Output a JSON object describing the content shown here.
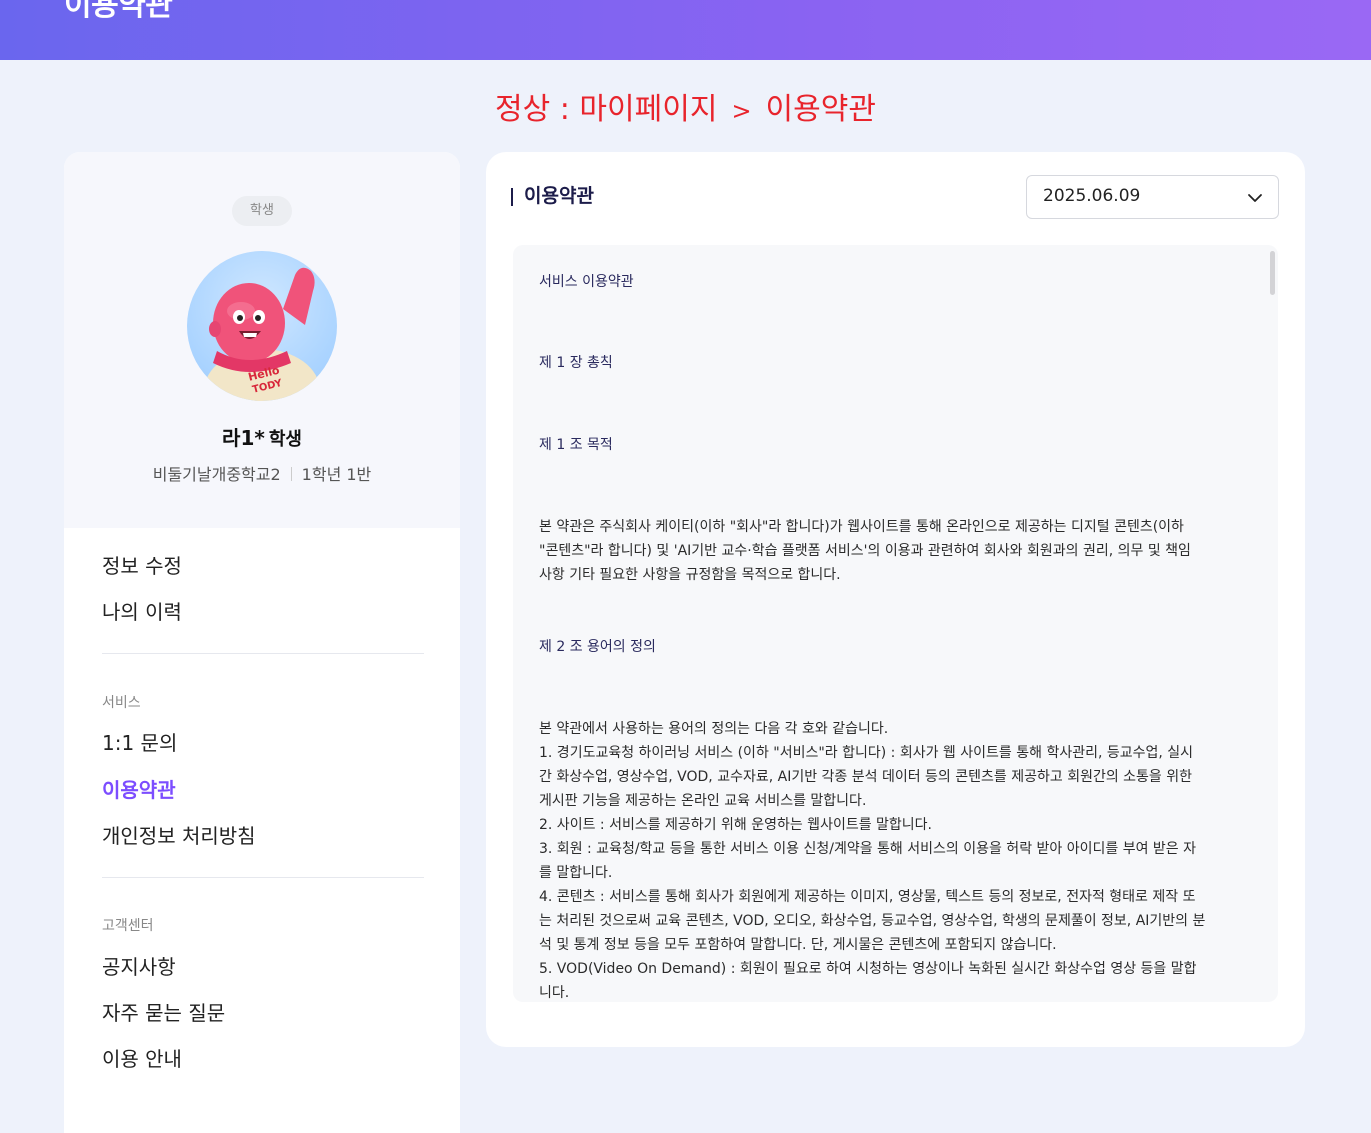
{
  "header": {
    "title": "이용약관"
  },
  "breadcrumb": {
    "prefix": "정상 : 마이페이지",
    "separator": ">",
    "current": "이용약관"
  },
  "profile": {
    "role_badge": "학생",
    "name": "라1*",
    "name_suffix": "학생",
    "school": "비둘기날개중학교2",
    "class": "1학년 1반"
  },
  "menu": {
    "edit_info": "정보 수정",
    "my_history": "나의 이력",
    "service_section": "서비스",
    "inquiry": "1:1 문의",
    "terms": "이용약관",
    "privacy": "개인정보 처리방침",
    "support_section": "고객센터",
    "notice": "공지사항",
    "faq": "자주 묻는 질문",
    "guide": "이용 안내"
  },
  "panel": {
    "title": "이용약관",
    "version_selected": "2025.06.09",
    "icons": {
      "dropdown": "chevron-down-icon"
    }
  },
  "terms": {
    "doc_title": "서비스 이용약관",
    "chapter": "제 1 장 총칙",
    "article1_title": "제 1 조 목적",
    "article1_l1": "본 약관은 주식회사 케이티(이하 \"회사\"라 합니다)가 웹사이트를 통해 온라인으로 제공하는 디지털 콘텐츠(이하",
    "article1_l2": "\"콘텐츠\"라 합니다) 및 'AI기반 교수·학습 플랫폼 서비스'의 이용과 관련하여 회사와 회원과의 권리, 의무 및 책임",
    "article1_l3": "사항 기타 필요한 사항을 규정함을 목적으로 합니다.",
    "article2_title": "제 2 조 용어의 정의",
    "article2_lines": [
      "본 약관에서 사용하는 용어의 정의는 다음 각 호와 같습니다.",
      "1. 경기도교육청 하이러닝 서비스 (이하 \"서비스\"라 합니다) : 회사가 웹 사이트를 통해 학사관리, 등교수업, 실시",
      "간 화상수업, 영상수업, VOD, 교수자료, AI기반 각종 분석 데이터 등의 콘텐츠를 제공하고 회원간의 소통을 위한",
      "게시판 기능을 제공하는 온라인 교육 서비스를 말합니다.",
      "2. 사이트 : 서비스를 제공하기 위해 운영하는 웹사이트를 말합니다.",
      "3. 회원 : 교육청/학교 등을 통한 서비스 이용 신청/계약을 통해 서비스의 이용을 허락 받아 아이디를 부여 받은 자",
      "를 말합니다.",
      "4. 콘텐츠 : 서비스를 통해 회사가 회원에게 제공하는 이미지, 영상물, 텍스트 등의 정보로, 전자적 형태로 제작 또",
      "는 처리된 것으로써 교육 콘텐츠, VOD, 오디오, 화상수업, 등교수업, 영상수업, 학생의 문제풀이 정보, AI기반의 분",
      "석 및 통계 정보 등을 모두 포함하여 말합니다. 단, 게시물은 콘텐츠에 포함되지 않습니다.",
      "5. VOD(Video On Demand) : 회원이 필요로 하여 시청하는 영상이나 녹화된 실시간 화상수업 영상 등을 말합",
      "니다."
    ]
  },
  "avatar": {
    "icons": {
      "avatar": "mascot-avatar-icon"
    },
    "shirt_text_1": "Hello",
    "shirt_text_2": "TODY"
  }
}
